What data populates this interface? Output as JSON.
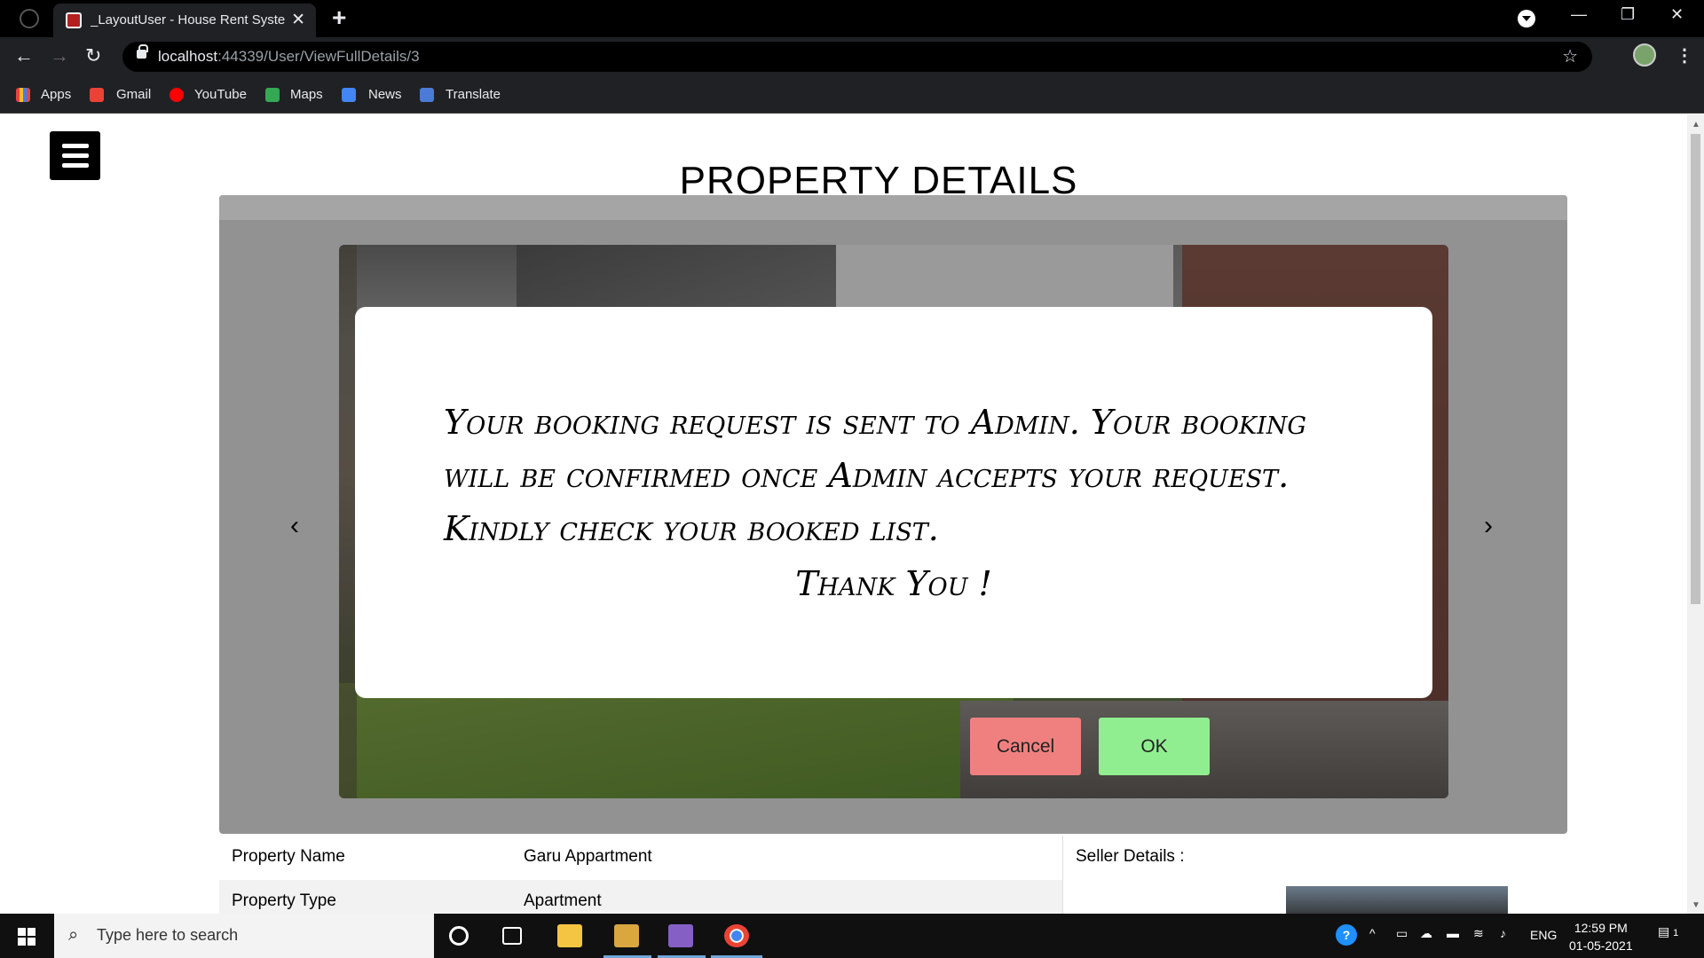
{
  "browser": {
    "tab_title": "_LayoutUser - House Rent System",
    "tab_close": "✕",
    "new_tab": "+",
    "url_host": "localhost",
    "url_rest": ":44339/User/ViewFullDetails/3",
    "bookmarks": [
      {
        "label": "Apps"
      },
      {
        "label": "Gmail"
      },
      {
        "label": "YouTube"
      },
      {
        "label": "Maps"
      },
      {
        "label": "News"
      },
      {
        "label": "Translate"
      }
    ],
    "colors": {
      "chrome": "#202124",
      "titlebar": "#000000"
    }
  },
  "page": {
    "title": "PROPERTY DETAILS",
    "carousel": {
      "prev": "‹",
      "next": "›"
    },
    "modal": {
      "message": "Your booking request is sent to Admin. Your booking will be confirmed once Admin accepts your request. Kindly check your booked list.",
      "thanks": "Thank You !"
    },
    "buttons": {
      "cancel": "Cancel",
      "ok": "OK",
      "cancel_color": "#f08080",
      "ok_color": "#90ee90"
    },
    "details": {
      "rows": [
        {
          "key": "Property Name",
          "value": "Garu Appartment"
        },
        {
          "key": "Property Type",
          "value": "Apartment"
        }
      ],
      "seller_label": "Seller Details :"
    }
  },
  "taskbar": {
    "search_placeholder": "Type here to search",
    "language": "ENG",
    "time": "12:59 PM",
    "date": "01-05-2021",
    "notification_count": "1"
  }
}
